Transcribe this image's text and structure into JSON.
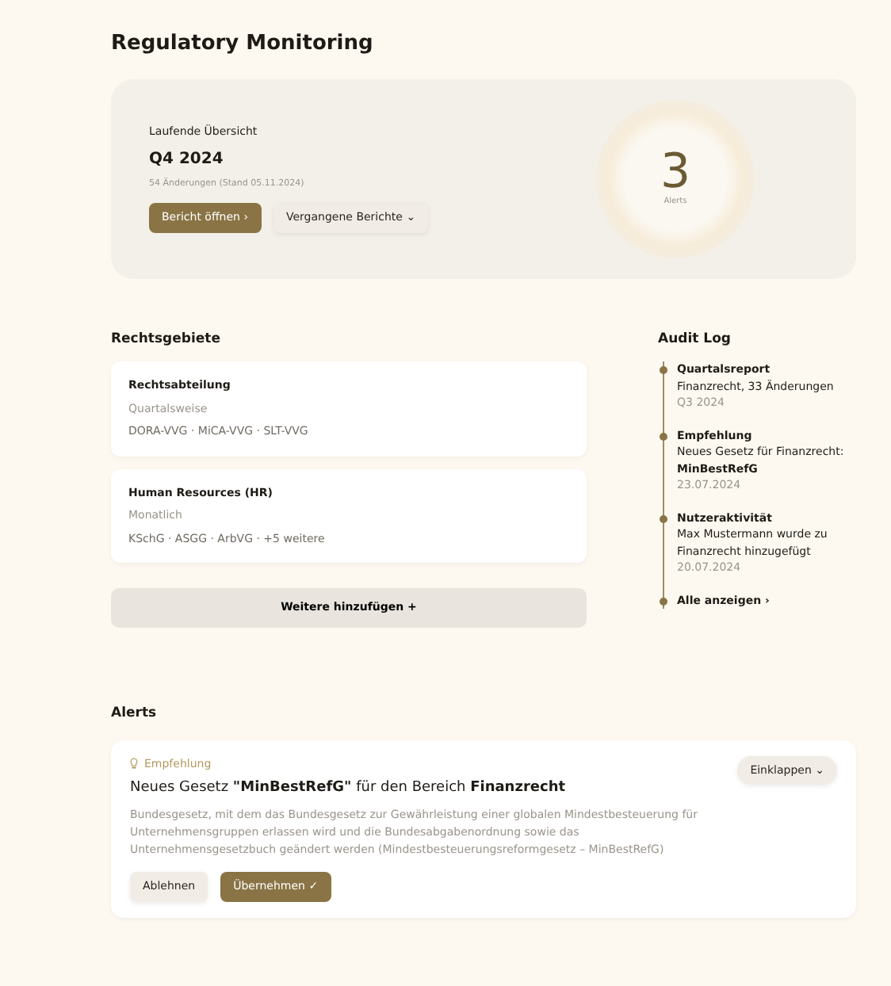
{
  "page_title": "Regulatory Monitoring",
  "overview": {
    "label": "Laufende Übersicht",
    "period": "Q4 2024",
    "subtitle": "54 Änderungen (Stand 05.11.2024)",
    "primary_button": "Bericht öffnen",
    "primary_icon": "›",
    "secondary_button": "Vergangene Berichte",
    "secondary_icon": "⌄",
    "count": "3",
    "count_label": "Alerts"
  },
  "areas": {
    "heading": "Rechtsgebiete",
    "items": [
      {
        "title": "Rechtsabteilung",
        "frequency": "Quartalsweise",
        "laws": "DORA-VVG · MiCA-VVG · SLT-VVG"
      },
      {
        "title": "Human Resources (HR)",
        "frequency": "Monatlich",
        "laws": "KSchG · ASGG · ArbVG · +5 weitere"
      }
    ],
    "add_button": "Weitere hinzufügen",
    "add_icon": "+"
  },
  "audit_log": {
    "heading": "Audit Log",
    "entries": [
      {
        "title": "Quartalsreport",
        "text": "Finanzrecht, 33 Änderungen",
        "date": "Q3 2024"
      },
      {
        "title": "Empfehlung",
        "text": "Neues Gesetz für Finanzrecht: **MinBestRefG**",
        "date": "23.07.2024"
      },
      {
        "title": "Nutzeraktivität",
        "text": "Max Mustermann wurde zu Finanzrecht hinzugefügt",
        "date": "20.07.2024"
      }
    ],
    "show_all": "Alle anzeigen",
    "show_all_icon": "›"
  },
  "alerts": {
    "heading": "Alerts",
    "items": [
      {
        "tag": "Empfehlung",
        "title": "Neues Gesetz **\"MinBestRefG\"** für den Bereich **Finanzrecht**",
        "expanded": true,
        "collapse_button": "Einklappen",
        "collapse_icon": "⌄",
        "body": "Bundesgesetz, mit dem das Bundesgesetz zur Gewährleistung einer globalen Mindestbesteuerung für Unternehmensgruppen erlassen wird und die Bundesabgabenordnung sowie das Unternehmensgesetzbuch geändert werden (Mindestbesteuerungsreformgesetz – MinBestRefG)",
        "reject_button": "Ablehnen",
        "accept_button": "Übernehmen",
        "accept_icon": "✓"
      }
    ]
  }
}
